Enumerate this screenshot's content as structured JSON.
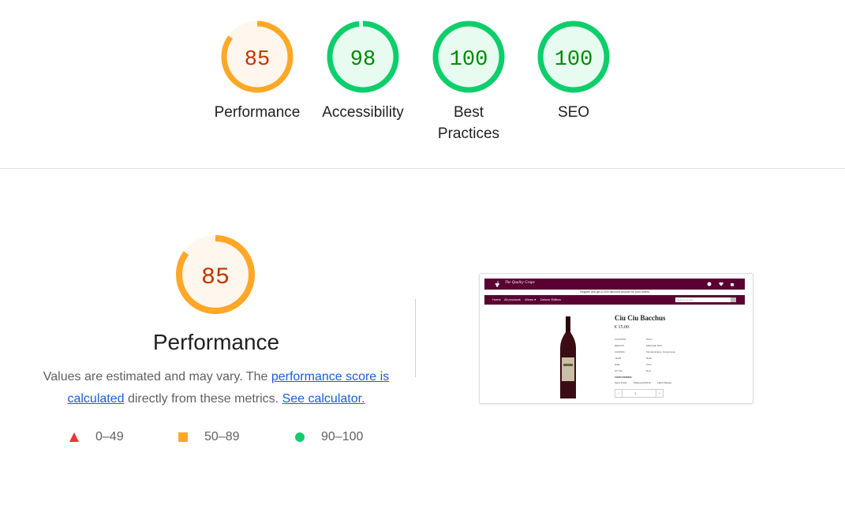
{
  "summary_gauges": [
    {
      "label": "Performance",
      "score": "85",
      "value": 85,
      "status": "average"
    },
    {
      "label": "Accessibility",
      "score": "98",
      "value": 98,
      "status": "pass"
    },
    {
      "label": "Best Practices",
      "score": "100",
      "value": 100,
      "status": "pass"
    },
    {
      "label": "SEO",
      "score": "100",
      "value": 100,
      "status": "pass"
    }
  ],
  "performance": {
    "score": "85",
    "value": 85,
    "title": "Performance",
    "desc_pre": "Values are estimated and may vary. The ",
    "link_score": "performance score is calculated",
    "desc_mid": " directly from these metrics. ",
    "link_calc": "See calculator."
  },
  "legend": [
    {
      "shape": "triangle",
      "label": "0–49",
      "color": "#e53935"
    },
    {
      "shape": "square",
      "label": "50–89",
      "color": "#ffa726"
    },
    {
      "shape": "circle",
      "label": "90–100",
      "color": "#0cce6b"
    }
  ],
  "colors": {
    "average_stroke": "#ffa726",
    "average_fill": "#fff7ed",
    "average_text": "#c33300",
    "pass_stroke": "#0cce6b",
    "pass_fill": "#e8fbf0",
    "pass_text": "#008800",
    "site_brand": "#5a0032"
  },
  "screenshot": {
    "brand": "The Quality Grape",
    "promo": "Register and get a 10% discount voucher for your orders",
    "nav": [
      "Home",
      "All products",
      "Wines ▾",
      "Deluxe Edition"
    ],
    "search_placeholder": "Search our site",
    "product_name": "Ciu Ciu Bacchus",
    "price": "€ 15.00",
    "specs": [
      {
        "k": "COUNTRY",
        "v": "ITALY"
      },
      {
        "k": "REGION",
        "v": "MARCHE DOC"
      },
      {
        "k": "GRAPES",
        "v": "Montepulciano, Sangiovese"
      },
      {
        "k": "YEAR",
        "v": "2018"
      },
      {
        "k": "SIZE",
        "v": "75CL"
      },
      {
        "k": "STYLE",
        "v": "Red"
      }
    ],
    "food_label": "FOOD PAIRING",
    "food": [
      "Spicy Food",
      "Pasta and Pizza",
      "Hard Cheese"
    ],
    "qty": "1"
  }
}
